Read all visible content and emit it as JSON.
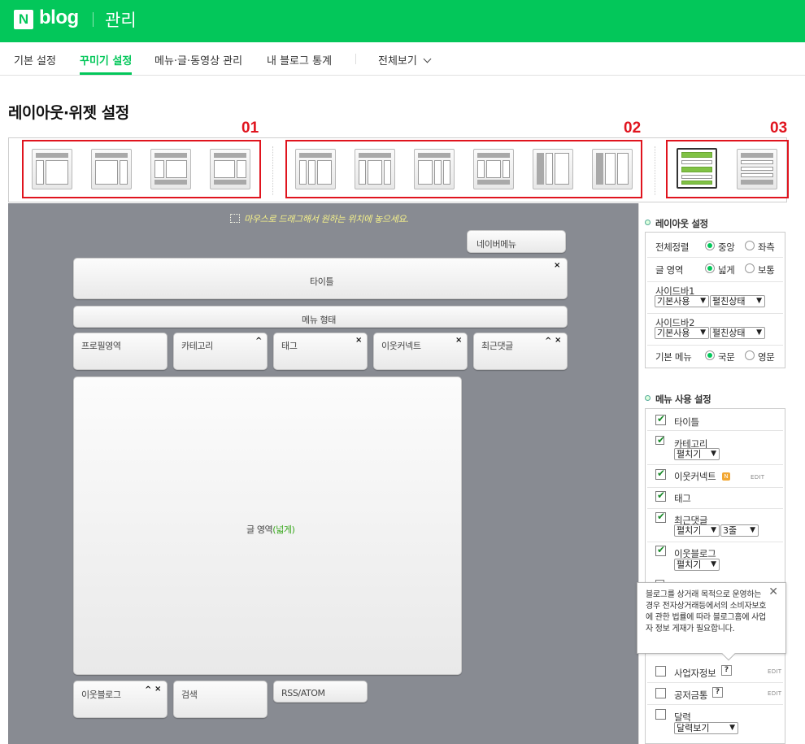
{
  "header": {
    "logo_n": "N",
    "logo_blog": "blog",
    "admin": "관리"
  },
  "nav": {
    "basic": "기본 설정",
    "design": "꾸미기 설정",
    "menu_posts": "메뉴·글·동영상 관리",
    "stats": "내 블로그 통계",
    "view_all": "전체보기"
  },
  "page_title": "레이아웃·위젯 설정",
  "groups": {
    "g1": "01",
    "g2": "02",
    "g3": "03"
  },
  "canvas": {
    "hint": "마우스로 드래그해서 원하는 위치에 놓으세요.",
    "naver_menu": "네이버메뉴",
    "title_widget": "타이틀",
    "menu_form": "메뉴 형태",
    "widgets_row": [
      "프로필영역",
      "카테고리",
      "태그",
      "이웃커넥트",
      "최근댓글"
    ],
    "post_area": "글 영역",
    "post_area_mode": "(넓게)",
    "bottom_widgets": [
      "이웃블로그",
      "검색",
      "RSS/ATOM"
    ],
    "close": "×",
    "up": "^"
  },
  "layout_settings": {
    "title": "레이아웃 설정",
    "align_label": "전체정렬",
    "align_center": "중앙",
    "align_left": "좌측",
    "post_label": "글 영역",
    "post_wide": "넓게",
    "post_normal": "보통",
    "sidebar1_label": "사이드바1",
    "sidebar1_use": "기본사용",
    "sidebar1_state": "펼친상태",
    "sidebar2_label": "사이드바2",
    "sidebar2_use": "기본사용",
    "sidebar2_state": "펼친상태",
    "menu_label": "기본 메뉴",
    "menu_ko": "국문",
    "menu_en": "영문"
  },
  "menu_settings": {
    "title": "메뉴 사용 설정",
    "items": {
      "title": "타이틀",
      "category": "카테고리",
      "category_mode": "펼치기",
      "neighbor_connect": "이웃커넥트",
      "neighbor_badge": "N",
      "tag": "태그",
      "recent_comments": "최근댓글",
      "recent_mode": "펼치기",
      "recent_lines": "3줄",
      "neighbor_blog": "이웃블로그",
      "neighbor_blog_mode": "펼치기",
      "business": "사업자정보",
      "donation": "공저금통",
      "calendar": "달력",
      "calendar_mode": "달력보기"
    },
    "edit": "EDIT",
    "qmark": "?"
  },
  "tooltip": {
    "text": "블로그를 상거래 목적으로 운영하는 경우 전자상거래등에서의 소비자보호에 관한 법률에 따라 블로그홈에 사업자 정보 게재가 필요합니다.",
    "close": "✕"
  }
}
